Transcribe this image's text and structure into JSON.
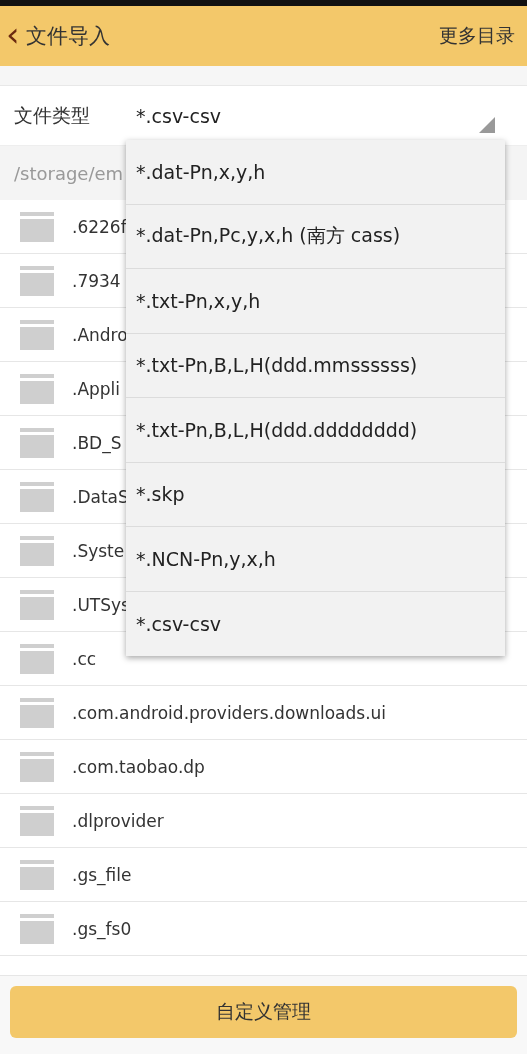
{
  "header": {
    "back": "‹",
    "title": "文件导入",
    "action": "更多目录"
  },
  "file_type": {
    "label": "文件类型",
    "value": "*.csv-csv"
  },
  "path": "/storage/em",
  "folders": [
    ".6226f",
    ".7934",
    ".Andro",
    ".Appli",
    ".BD_S",
    ".DataS",
    ".Syste",
    ".UTSys",
    ".cc",
    ".com.android.providers.downloads.ui",
    ".com.taobao.dp",
    ".dlprovider",
    ".gs_file",
    ".gs_fs0"
  ],
  "dropdown": [
    "*.dat-Pn,x,y,h",
    "*.dat-Pn,Pc,y,x,h (南方 cass)",
    "*.txt-Pn,x,y,h",
    "*.txt-Pn,B,L,H(ddd.mmssssss)",
    "*.txt-Pn,B,L,H(ddd.dddddddd)",
    "*.skp",
    "*.NCN-Pn,y,x,h",
    "*.csv-csv"
  ],
  "button": "自定义管理"
}
